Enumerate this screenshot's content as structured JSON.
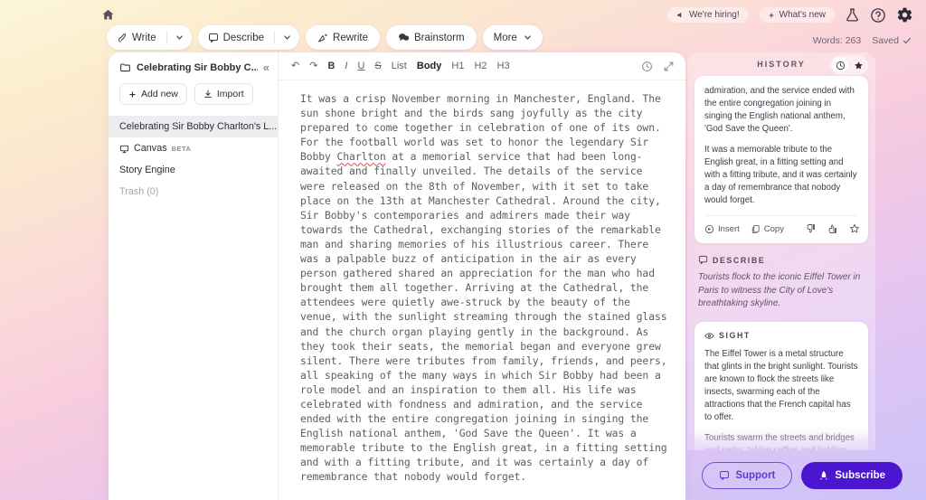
{
  "topbar": {
    "home_icon": "home-icon",
    "actions": [
      {
        "label": "Write",
        "icon": "pen-icon",
        "has_caret": true
      },
      {
        "label": "Describe",
        "icon": "speech-bubble-icon",
        "has_caret": true
      },
      {
        "label": "Rewrite",
        "icon": "magic-wand-icon",
        "has_caret": false
      },
      {
        "label": "Brainstorm",
        "icon": "brain-chat-icon",
        "has_caret": false
      }
    ],
    "more_label": "More"
  },
  "top_right": {
    "hiring_label": "We're hiring!",
    "whats_new_label": "What's new",
    "icons": [
      "flask-icon",
      "help-icon",
      "settings-gear-icon"
    ],
    "words_label": "Words: 263",
    "saved_label": "Saved"
  },
  "sidebar": {
    "doc_title": "Celebrating Sir Bobby C...",
    "add_new_label": "Add new",
    "import_label": "Import",
    "items": [
      {
        "label": "Celebrating Sir Bobby Charlton's L...",
        "active": true,
        "icon": null,
        "badge": null
      },
      {
        "label": "Canvas",
        "active": false,
        "icon": "canvas-icon",
        "badge": "BETA"
      },
      {
        "label": "Story Engine",
        "active": false,
        "icon": null,
        "badge": null
      },
      {
        "label": "Trash (0)",
        "active": false,
        "icon": null,
        "badge": null,
        "muted": true
      }
    ]
  },
  "toolbar": {
    "undo": "↶",
    "redo": "↷",
    "bold": "B",
    "italic": "I",
    "underline": "U",
    "strike": "S",
    "list": "List",
    "body": "Body",
    "h1": "H1",
    "h2": "H2",
    "h3": "H3"
  },
  "document": {
    "part1": "It was a crisp November morning in Manchester, England. The sun shone bright and the birds sang joyfully as the city prepared to come together in celebration of one of its own. For the football world was set to honor the legendary Sir Bobby ",
    "misspelled": "Charlton",
    "part2": " at a memorial service that had been long-awaited and finally unveiled. The details of the service were released on the 8th of November, with it set to take place on the 13th at Manchester Cathedral. Around the city, Sir Bobby's contemporaries and admirers made their way towards the Cathedral, exchanging stories of the remarkable man and sharing memories of his illustrious career. There was a palpable buzz of anticipation in the air as every person gathered shared an appreciation for the man who had brought them all together. Arriving at the Cathedral, the attendees were quietly awe-struck by the beauty of the venue, with the sunlight streaming through the stained glass and the church organ playing gently in the background. As they took their seats, the memorial began and everyone grew silent. There were tributes from family, friends, and peers, all speaking of the many ways in which Sir Bobby had been a role model and an inspiration to them all. His life was celebrated with fondness and admiration, and the service ended with the entire congregation joining in singing the English national anthem, 'God Save the Queen'. It was a memorable tribute to the English great, in a fitting setting and with a fitting tribute, and it was certainly a day of remembrance that nobody would forget."
  },
  "right_panel": {
    "title": "HISTORY",
    "tabs": [
      {
        "icon": "clock-icon",
        "active": true
      },
      {
        "icon": "star-icon",
        "active": false
      }
    ],
    "history_card": {
      "para1": "admiration, and the service ended with the entire congregation joining in singing the English national anthem, 'God Save the Queen'.",
      "para2": "It was a memorable tribute to the English great, in a fitting setting and with a fitting tribute, and it was certainly a day of remembrance that nobody would forget.",
      "insert_label": "Insert",
      "copy_label": "Copy"
    },
    "describe_section": {
      "label": "DESCRIBE",
      "prompt": "Tourists flock to the iconic Eiffel Tower in Paris to witness the City of Love's breathtaking skyline.",
      "sight_card": {
        "label": "SIGHT",
        "para1": "The Eiffel Tower is a metal structure that glints in the bright sunlight. Tourists are known to flock the streets like insects, swarming each of the attractions that the French capital has to offer.",
        "para2": "Tourists swarm the streets and bridges and parks, taking selfies and holding"
      }
    }
  },
  "bottom": {
    "support_label": "Support",
    "subscribe_label": "Subscribe"
  },
  "colors": {
    "accent_purple": "#4a16cf",
    "support_border": "#6f4fe0",
    "spell_error": "#e06868"
  }
}
